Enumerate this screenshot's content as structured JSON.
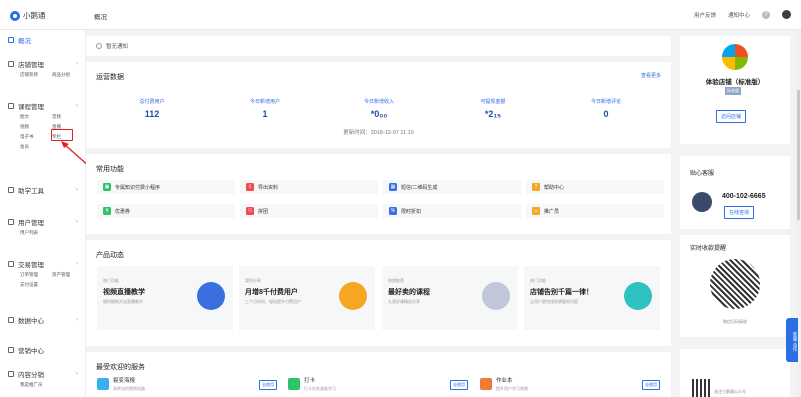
{
  "brand": {
    "name": "小鹅通"
  },
  "header": {
    "breadcrumb": "概况",
    "links": [
      "用户反馈",
      "通知中心"
    ],
    "help": "?"
  },
  "sidebar": {
    "groups": [
      {
        "label": "概况",
        "subs": []
      },
      {
        "label": "店铺管理",
        "subs": [
          [
            "店铺装修",
            "商品分组"
          ]
        ]
      },
      {
        "label": "课程管理",
        "subs": [
          [
            "图文",
            "音频"
          ],
          [
            "视频",
            "直播"
          ],
          [
            "电子书",
            "专栏"
          ],
          [
            "会员",
            ""
          ]
        ]
      },
      {
        "label": "助学工具",
        "subs": []
      },
      {
        "label": "用户管理",
        "subs": [
          [
            "用户列表",
            ""
          ]
        ]
      },
      {
        "label": "交易管理",
        "subs": [
          [
            "订单管理",
            "资产管理"
          ],
          [
            "支付设置",
            ""
          ]
        ]
      },
      {
        "label": "数据中心",
        "subs": []
      },
      {
        "label": "营销中心",
        "subs": []
      },
      {
        "label": "内容分销",
        "subs": [
          [
            "我是推广员",
            ""
          ]
        ]
      }
    ]
  },
  "notice": {
    "text": "暂无通知"
  },
  "ops": {
    "title": "运营数据",
    "more": "查看更多",
    "stats": [
      {
        "label": "总付费用户",
        "value": "112"
      },
      {
        "label": "今日新增用户",
        "value": "1"
      },
      {
        "label": "今日新增收入",
        "value": "*0₀₀"
      },
      {
        "label": "可提现金额",
        "value": "*2₁₅"
      },
      {
        "label": "今日新增评论",
        "value": "0"
      }
    ],
    "updated": "更新时间：2018-12-07 11:10"
  },
  "functions": {
    "title": "常用功能",
    "items": [
      {
        "label": "专属知识付费小程序",
        "color": "#2ec26b",
        "icon": "▣"
      },
      {
        "label": "导出资料",
        "color": "#f04a4a",
        "icon": "⇩"
      },
      {
        "label": "短信/二维码生成",
        "color": "#3b6fe0",
        "icon": "▦"
      },
      {
        "label": "帮助中心",
        "color": "#f5a623",
        "icon": "?"
      },
      {
        "label": "优惠券",
        "color": "#2ec26b",
        "icon": "¥"
      },
      {
        "label": "拼团",
        "color": "#f04a4a",
        "icon": "⚇"
      },
      {
        "label": "限时折扣",
        "color": "#3b6fe0",
        "icon": "%"
      },
      {
        "label": "推广员",
        "color": "#f5a623",
        "icon": "☺"
      }
    ]
  },
  "products": {
    "title": "产品动态",
    "items": [
      {
        "tag": "热门功能",
        "title": "视频直播教学",
        "sub": "随时随地开启直播教学",
        "color": "#3b6fe0"
      },
      {
        "tag": "案例分享",
        "title": "月增8千付费用户",
        "sub": "三个月时间，轻松提升付费用户",
        "color": "#f5a623"
      },
      {
        "tag": "热销推荐",
        "title": "最好卖的课程",
        "sub": "九类好课精选分享",
        "color": "#c0c8d8"
      },
      {
        "tag": "热门功能",
        "title": "店铺告别千篇一律！",
        "sub": "让用户更快找到想要的内容",
        "color": "#2ec2c2"
      }
    ]
  },
  "services": {
    "title": "最受欢迎的服务",
    "items": [
      {
        "title": "裂变海报",
        "desc": "高转化的营销利器",
        "badge": "去使用",
        "color": "#3bb0ef"
      },
      {
        "title": "打卡",
        "desc": "打卡任务激励学习",
        "badge": "去使用",
        "color": "#2ec26b"
      },
      {
        "title": "作业本",
        "desc": "提升用户学习效果",
        "badge": "去使用",
        "color": "#f07a3a"
      }
    ]
  },
  "shop": {
    "name": "体验店铺（标准版）",
    "badge": "标准版",
    "visit": "访问店铺"
  },
  "support": {
    "title": "贴心客服",
    "phone": "400-102-6665",
    "online": "在线咨询"
  },
  "live": {
    "title": "实时收款提醒",
    "scan": "微信扫码接收"
  },
  "promo": {
    "text": "关注小鹅通公众号"
  },
  "float": {
    "label": "客服·合作"
  }
}
